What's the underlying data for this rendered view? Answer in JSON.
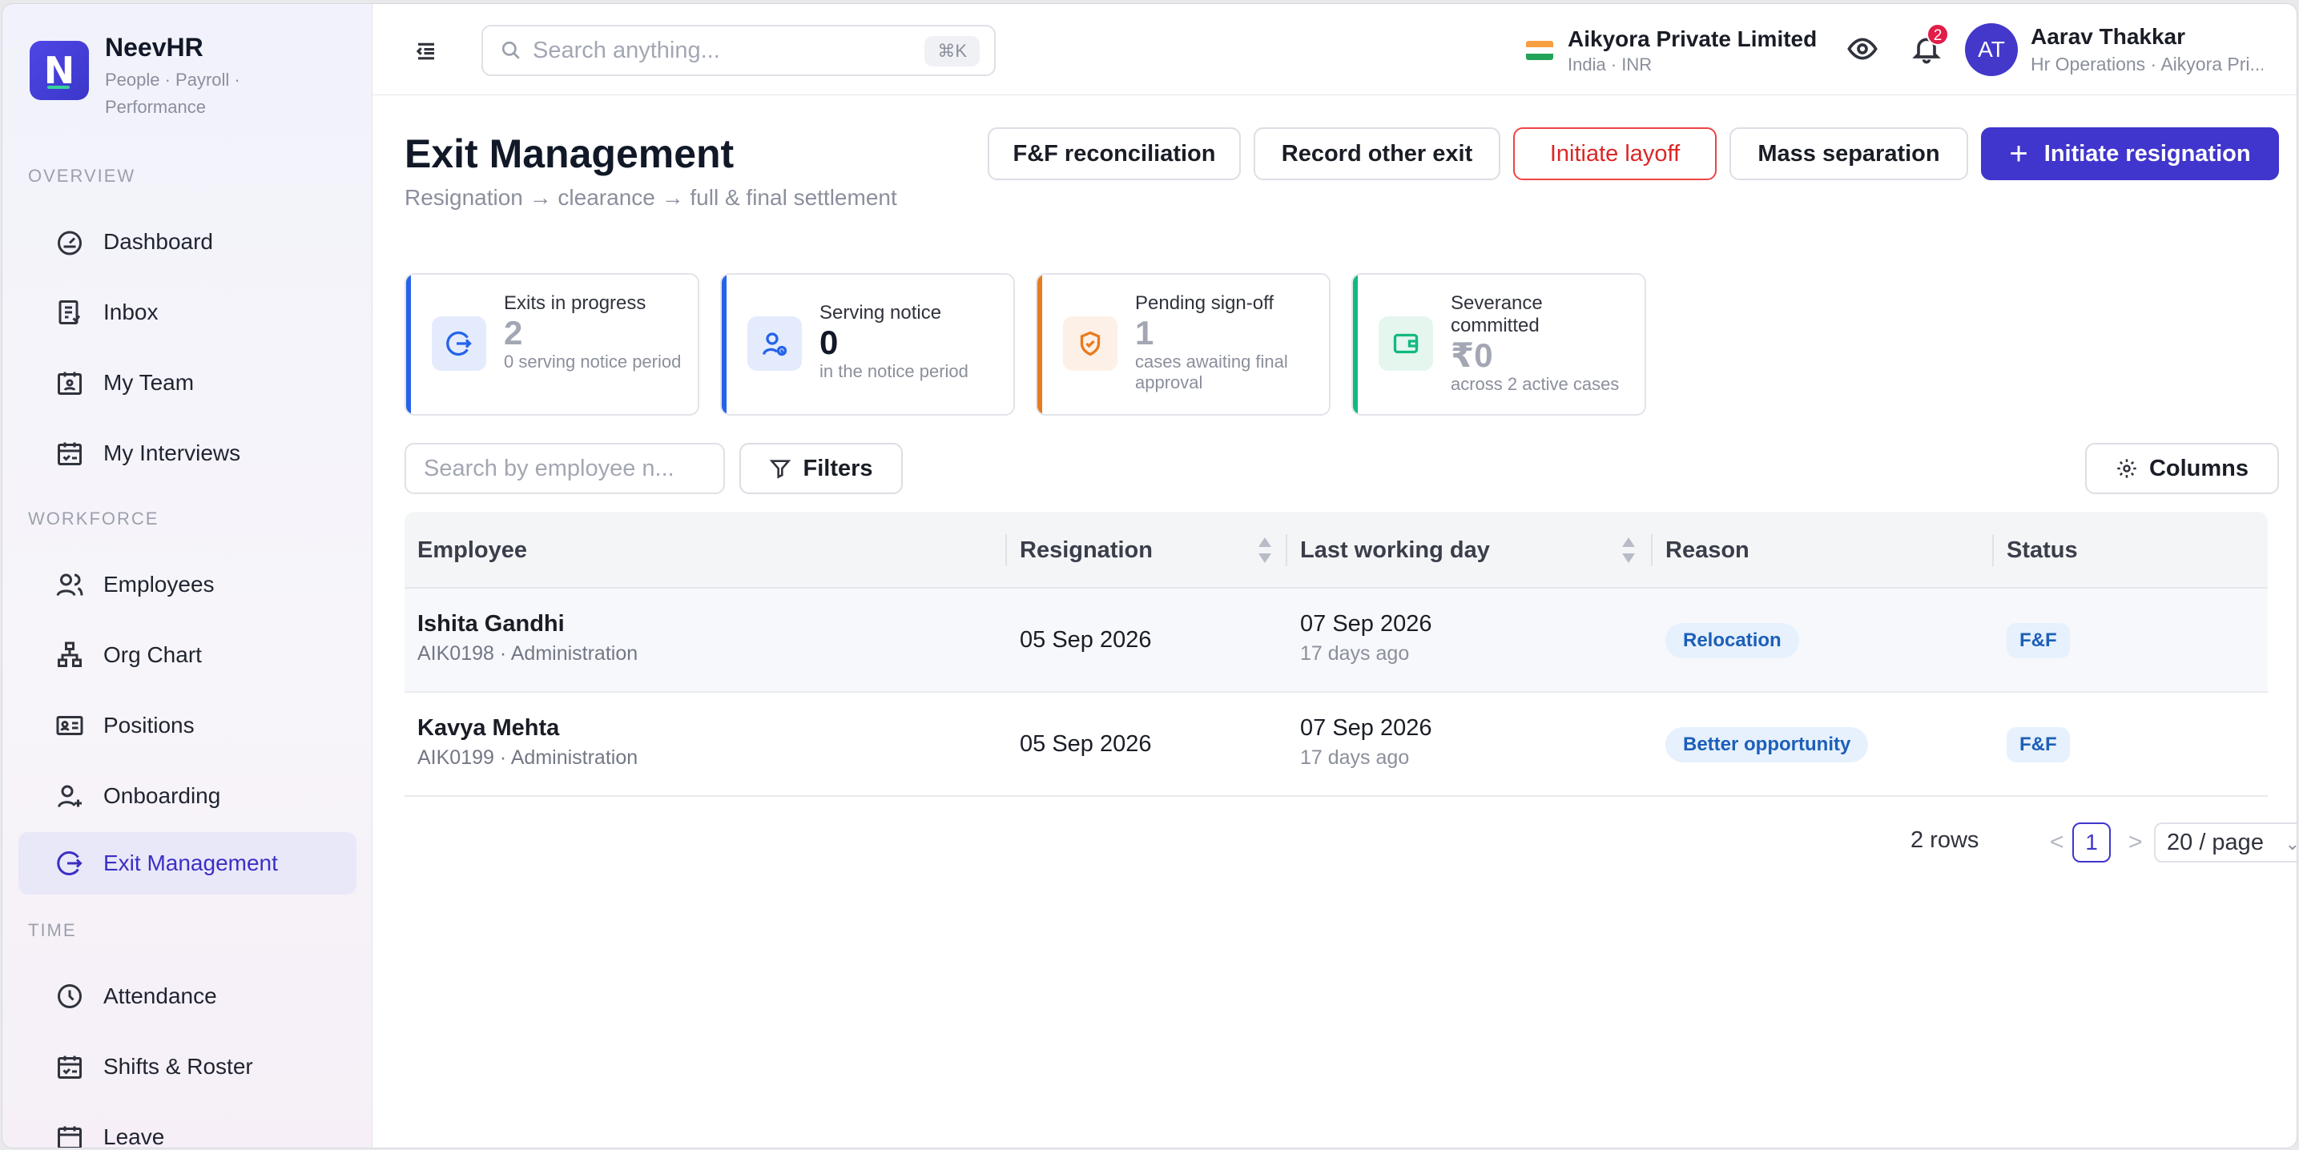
{
  "brand": {
    "name": "NeevHR",
    "tagline": "People · Payroll · Performance",
    "logo_letter": "N",
    "color": "#4f46e5"
  },
  "sidebar": {
    "sections": [
      {
        "label": "OVERVIEW",
        "items": [
          {
            "label": "Dashboard",
            "icon": "dashboard-gauge-icon"
          },
          {
            "label": "Inbox",
            "icon": "inbox-clipboard-icon"
          },
          {
            "label": "My Team",
            "icon": "team-calendar-icon"
          },
          {
            "label": "My Interviews",
            "icon": "interviews-calendar-icon"
          }
        ]
      },
      {
        "label": "WORKFORCE",
        "items": [
          {
            "label": "Employees",
            "icon": "employees-icon"
          },
          {
            "label": "Org Chart",
            "icon": "org-chart-icon"
          },
          {
            "label": "Positions",
            "icon": "positions-id-card-icon"
          },
          {
            "label": "Onboarding",
            "icon": "onboarding-user-plus-icon"
          },
          {
            "label": "Exit Management",
            "icon": "exit-arrow-icon",
            "active": true
          }
        ]
      },
      {
        "label": "TIME",
        "items": [
          {
            "label": "Attendance",
            "icon": "clock-icon"
          },
          {
            "label": "Shifts & Roster",
            "icon": "roster-calendar-icon"
          },
          {
            "label": "Leave",
            "icon": "leave-calendar-icon"
          }
        ]
      }
    ]
  },
  "topbar": {
    "search_placeholder": "Search anything...",
    "search_shortcut": "⌘K",
    "org_name": "Aikyora Private Limited",
    "org_region": "India · INR",
    "notifications_count": "2",
    "user_initials": "AT",
    "user_name": "Aarav Thakkar",
    "user_role": "Hr Operations · Aikyora Pri..."
  },
  "page": {
    "title": "Exit Management",
    "subtitle": "Resignation → clearance → full & final settlement",
    "actions": {
      "ff_reconciliation": "F&F reconciliation",
      "record_other_exit": "Record other exit",
      "initiate_layoff": "Initiate layoff",
      "mass_separation": "Mass separation",
      "initiate_resignation": "Initiate resignation"
    }
  },
  "stats": [
    {
      "label": "Exits in progress",
      "value": "2",
      "foot": "0 serving notice period",
      "accent": "#2563eb",
      "icon": "exit-arrow-icon"
    },
    {
      "label": "Serving notice",
      "value": "0",
      "foot": "in the notice period",
      "accent": "#2563eb",
      "icon": "user-clock-icon"
    },
    {
      "label": "Pending sign-off",
      "value": "1",
      "foot": "cases awaiting final approval",
      "accent": "#ea7a1c",
      "icon": "shield-check-icon"
    },
    {
      "label": "Severance committed",
      "value": "₹0",
      "foot": "across 2 active cases",
      "accent": "#10b981",
      "icon": "wallet-icon"
    }
  ],
  "filters": {
    "employee_search_placeholder": "Search by employee n...",
    "filters_label": "Filters",
    "columns_label": "Columns"
  },
  "table": {
    "columns": [
      "Employee",
      "Resignation",
      "Last working day",
      "Reason",
      "Status"
    ],
    "rows": [
      {
        "name": "Ishita Gandhi",
        "meta": "AIK0198 · Administration",
        "resignation": "05 Sep 2026",
        "last_day": "07 Sep 2026",
        "last_day_rel": "17 days ago",
        "reason": "Relocation",
        "status": "F&F"
      },
      {
        "name": "Kavya Mehta",
        "meta": "AIK0199 · Administration",
        "resignation": "05 Sep 2026",
        "last_day": "07 Sep 2026",
        "last_day_rel": "17 days ago",
        "reason": "Better opportunity",
        "status": "F&F"
      }
    ]
  },
  "pagination": {
    "rows_label": "2 rows",
    "prev": "<",
    "current_page": "1",
    "next": ">",
    "page_size": "20 / page"
  }
}
